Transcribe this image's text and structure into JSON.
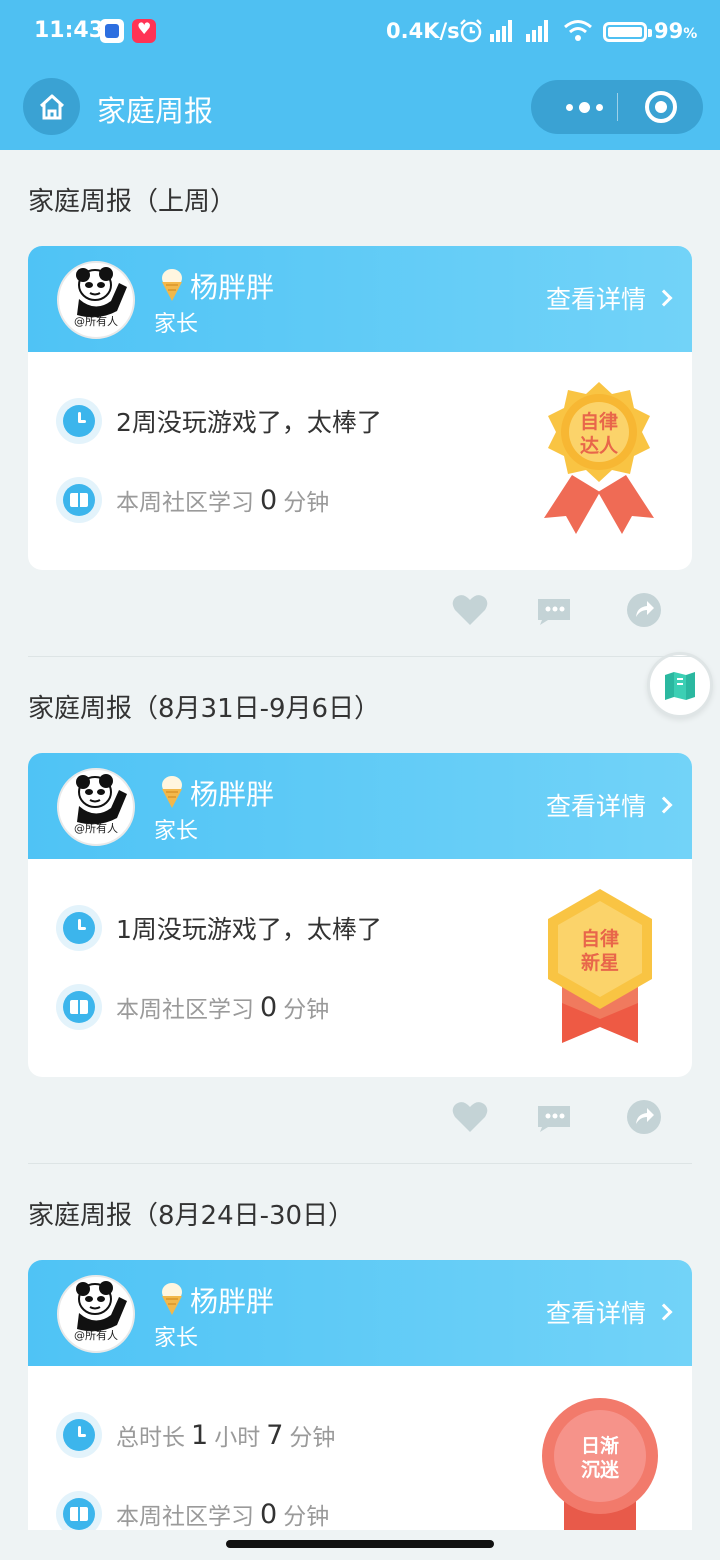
{
  "status_bar": {
    "time": "11:43",
    "network_speed": "0.4K/s",
    "battery": "99",
    "battery_unit": "%"
  },
  "nav": {
    "title": "家庭周报"
  },
  "reports": [
    {
      "title": "家庭周报（上周）",
      "user": {
        "name": "杨胖胖",
        "role": "家长",
        "avatar_caption": "@所有人"
      },
      "detail_label": "查看详情",
      "line1": {
        "type": "text",
        "text": "2周没玩游戏了，太棒了"
      },
      "line2": {
        "prefix": "本周社区学习",
        "value": "0",
        "unit": "分钟"
      },
      "badge": {
        "text1": "自律",
        "text2": "达人",
        "style": "gold-sun"
      }
    },
    {
      "title": "家庭周报（8月31日-9月6日）",
      "user": {
        "name": "杨胖胖",
        "role": "家长",
        "avatar_caption": "@所有人"
      },
      "detail_label": "查看详情",
      "line1": {
        "type": "text",
        "text": "1周没玩游戏了，太棒了"
      },
      "line2": {
        "prefix": "本周社区学习",
        "value": "0",
        "unit": "分钟"
      },
      "badge": {
        "text1": "自律",
        "text2": "新星",
        "style": "gold-hex"
      }
    },
    {
      "title": "家庭周报（8月24日-30日）",
      "user": {
        "name": "杨胖胖",
        "role": "家长",
        "avatar_caption": "@所有人"
      },
      "detail_label": "查看详情",
      "line1": {
        "type": "duration",
        "prefix": "总时长",
        "hours": "1",
        "hours_unit": "小时",
        "minutes": "7",
        "minutes_unit": "分钟"
      },
      "line2": {
        "prefix": "本周社区学习",
        "value": "0",
        "unit": "分钟"
      },
      "badge": {
        "text1": "日渐",
        "text2": "沉迷",
        "style": "red-round"
      }
    }
  ],
  "icons": {
    "like": "heart-icon",
    "comment": "comment-icon",
    "share": "share-icon",
    "home": "home-icon",
    "float": "map-book-icon"
  },
  "colors": {
    "accent": "#4fc0f2",
    "badge_gold": "#f7b733",
    "badge_red": "#f06a5a"
  }
}
